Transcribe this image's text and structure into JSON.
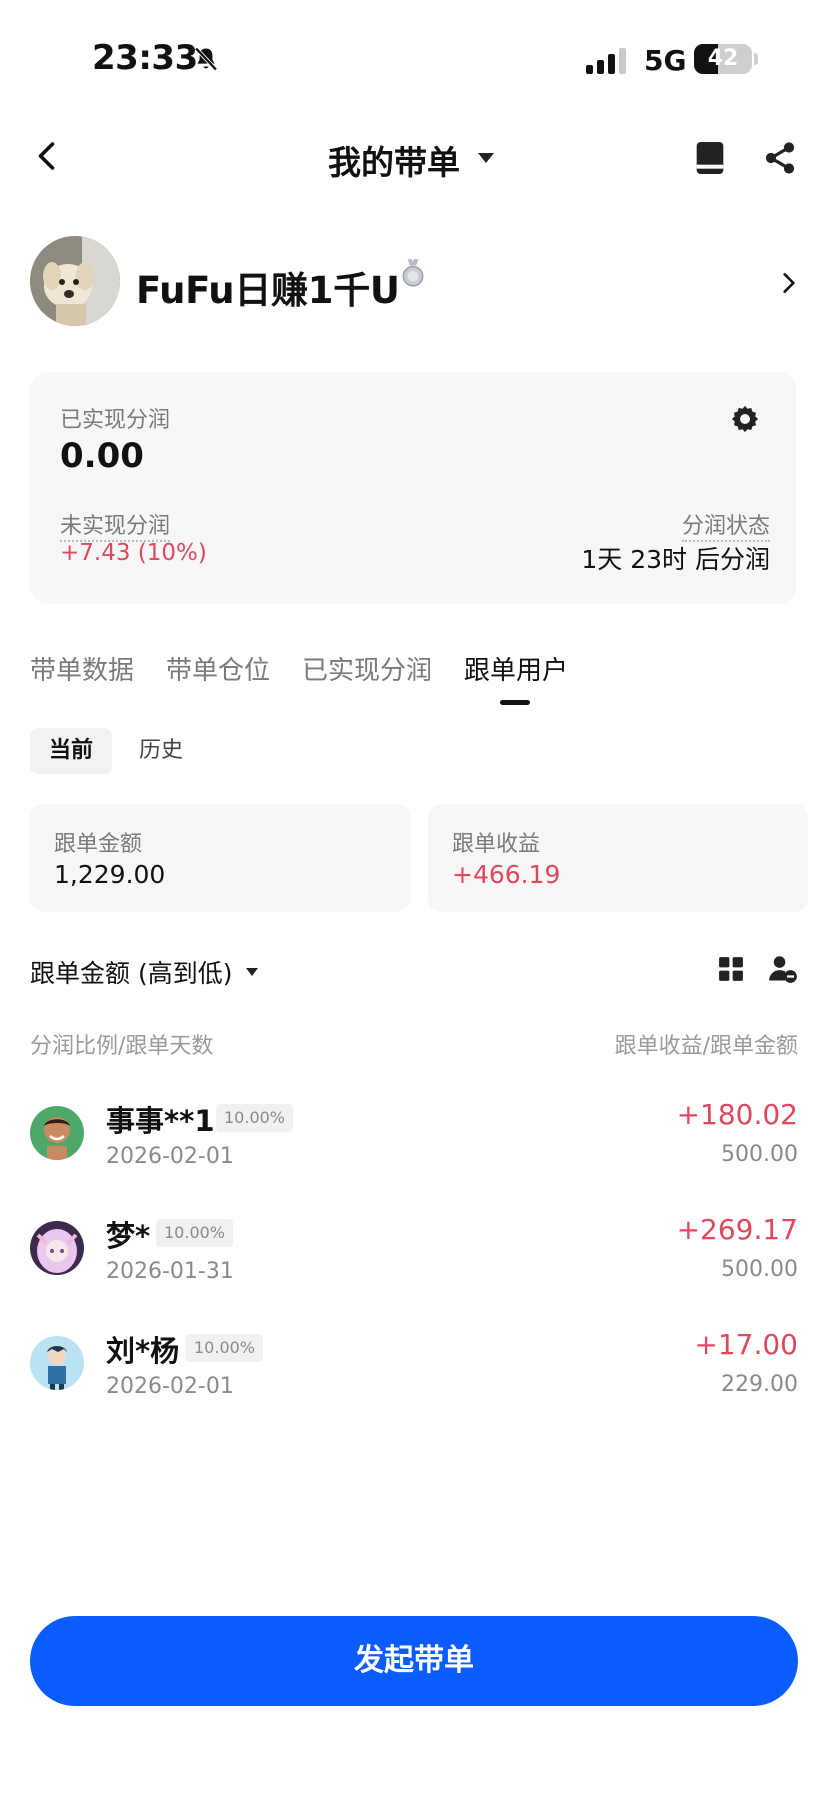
{
  "status_bar": {
    "time": "23:33",
    "network": "5G",
    "battery": "42",
    "battery_level": 0.42
  },
  "nav": {
    "title": "我的带单"
  },
  "profile": {
    "name": "FuFu日赚1千U"
  },
  "summary": {
    "realized_label": "已实现分润",
    "realized_value": "0.00",
    "unrealized_label": "未实现分润",
    "unrealized_value": "+7.43 (10%)",
    "state_label": "分润状态",
    "state_value": "1天 23时 后分润"
  },
  "tabs": [
    "带单数据",
    "带单仓位",
    "已实现分润",
    "跟单用户"
  ],
  "active_tab": 3,
  "sub_tabs": {
    "current": "当前",
    "history": "历史"
  },
  "stats": {
    "amount_label": "跟单金额",
    "amount_value": "1,229.00",
    "profit_label": "跟单收益",
    "profit_value": "+466.19"
  },
  "sort": {
    "label": "跟单金额 (高到低)"
  },
  "columns": {
    "left": "分润比例/跟单天数",
    "right": "跟单收益/跟单金额"
  },
  "followers": [
    {
      "name": "事事**1",
      "ratio": "10.00%",
      "date": "2026-02-01",
      "profit": "+180.02",
      "amount": "500.00"
    },
    {
      "name": "梦*",
      "ratio": "10.00%",
      "date": "2026-01-31",
      "profit": "+269.17",
      "amount": "500.00"
    },
    {
      "name": "刘*杨",
      "ratio": "10.00%",
      "date": "2026-02-01",
      "profit": "+17.00",
      "amount": "229.00"
    }
  ],
  "cta": {
    "label": "发起带单"
  },
  "colors": {
    "accent": "#0b5cff",
    "positive": "#e0485e",
    "card": "#f7f7f8"
  }
}
